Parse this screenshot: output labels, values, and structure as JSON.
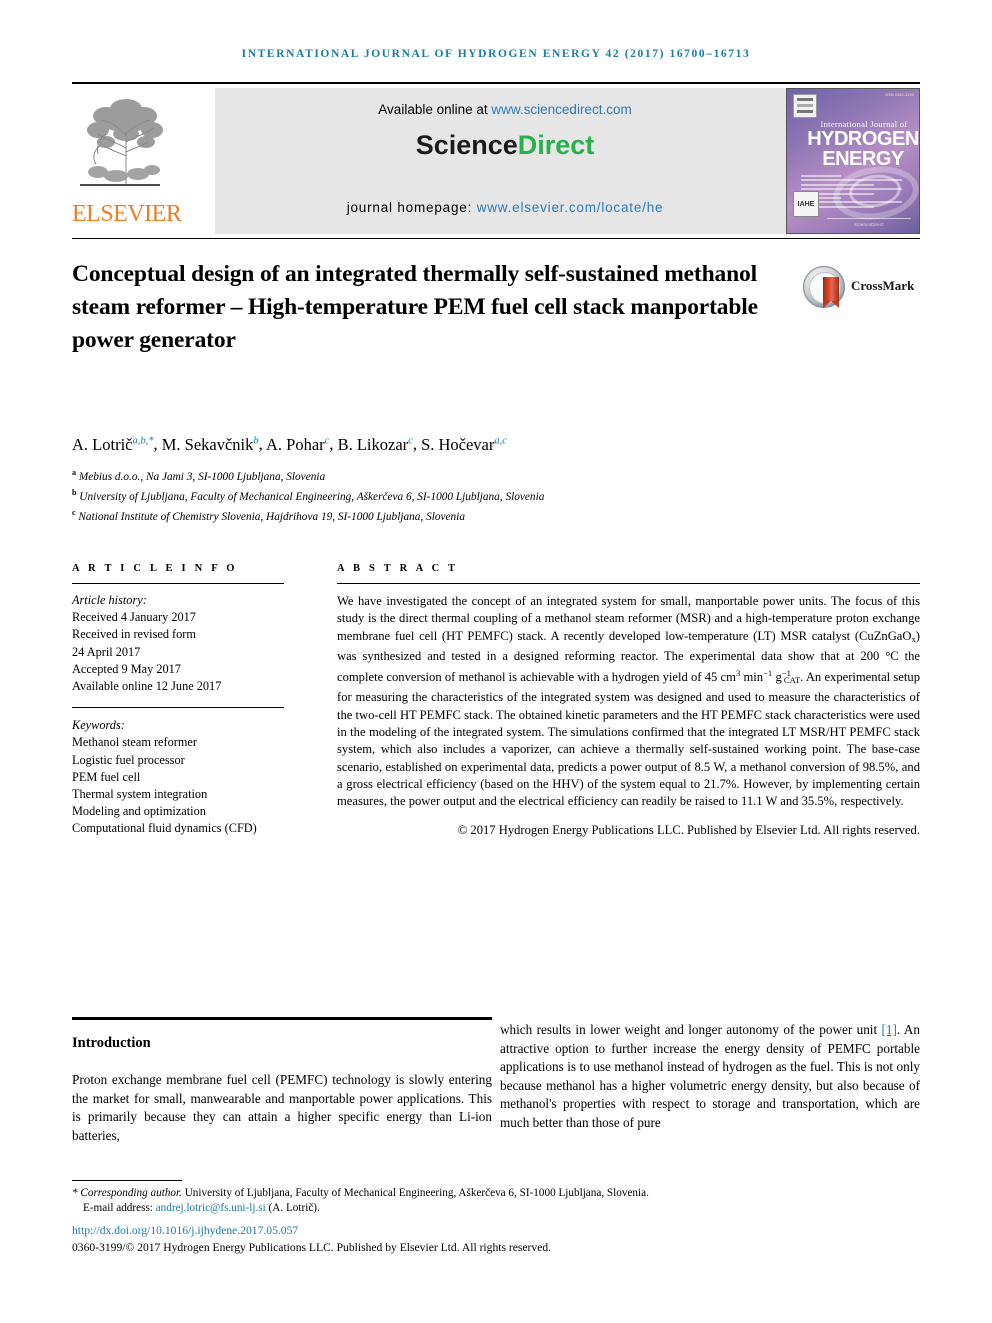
{
  "running_head": "International Journal of Hydrogen Energy 42 (2017) 16700–16713",
  "masthead": {
    "publisher_name": "ELSEVIER",
    "publisher_logo_alt": "elsevier-tree-logo",
    "available_online_label": "Available online at",
    "available_online_url": "www.sciencedirect.com",
    "brand_part1": "Science",
    "brand_part2": "Direct",
    "homepage_label": "journal homepage:",
    "homepage_url": "www.elsevier.com/locate/he",
    "cover": {
      "line1": "International Journal of",
      "line2": "HYDROGEN",
      "line3": "ENERGY",
      "footer": "ScienceDirect",
      "badge_label": "IAHE",
      "corner_note": "ISSN 0360-3199"
    }
  },
  "article": {
    "title": "Conceptual design of an integrated thermally self-sustained methanol steam reformer – High-temperature PEM fuel cell stack manportable power generator",
    "crossmark_label": "CrossMark",
    "authors": [
      {
        "name": "A. Lotrič",
        "marks": "a,b,*"
      },
      {
        "name": "M. Sekavčnik",
        "marks": "b"
      },
      {
        "name": "A. Pohar",
        "marks": "c"
      },
      {
        "name": "B. Likozar",
        "marks": "c"
      },
      {
        "name": "S. Hočevar",
        "marks": "a,c"
      }
    ],
    "affiliations": [
      {
        "mark": "a",
        "text": "Mebius d.o.o., Na Jami 3, SI-1000 Ljubljana, Slovenia"
      },
      {
        "mark": "b",
        "text": "University of Ljubljana, Faculty of Mechanical Engineering, Aškerčeva 6, SI-1000 Ljubljana, Slovenia"
      },
      {
        "mark": "c",
        "text": "National Institute of Chemistry Slovenia, Hajdrihova 19, SI-1000 Ljubljana, Slovenia"
      }
    ]
  },
  "article_info": {
    "heading": "A R T I C L E  I N F O",
    "history_label": "Article history:",
    "history": [
      "Received 4 January 2017",
      "Received in revised form",
      "24 April 2017",
      "Accepted 9 May 2017",
      "Available online 12 June 2017"
    ],
    "keywords_label": "Keywords:",
    "keywords": [
      "Methanol steam reformer",
      "Logistic fuel processor",
      "PEM fuel cell",
      "Thermal system integration",
      "Modeling and optimization",
      "Computational fluid dynamics (CFD)"
    ]
  },
  "abstract": {
    "heading": "A B S T R A C T",
    "paragraph_part1": "We have investigated the concept of an integrated system for small, manportable power units. The focus of this study is the direct thermal coupling of a methanol steam reformer (MSR) and a high-temperature proton exchange membrane fuel cell (HT PEMFC) stack. A recently developed low-temperature (LT) MSR catalyst (CuZnGaO",
    "catalyst_sub": "x",
    "paragraph_part2": ") was synthesized and tested in a designed reforming reactor. The experimental data show that at 200 °C the complete conversion of methanol is achievable with a hydrogen yield of 45 cm",
    "unit_sup1": "3",
    "paragraph_part3": " min",
    "unit_sup2": "−1",
    "paragraph_part4": " g",
    "unit_sub_cat": "CAT",
    "unit_sup3": "−1",
    "paragraph_part5": ". An experimental setup for measuring the characteristics of the integrated system was designed and used to measure the characteristics of the two-cell HT PEMFC stack. The obtained kinetic parameters and the HT PEMFC stack characteristics were used in the modeling of the integrated system. The simulations confirmed that the integrated LT MSR/HT PEMFC stack system, which also includes a vaporizer, can achieve a thermally self-sustained working point. The base-case scenario, established on experimental data, predicts a power output of 8.5 W, a methanol conversion of 98.5%, and a gross electrical efficiency (based on the HHV) of the system equal to 21.7%. However, by implementing certain measures, the power output and the electrical efficiency can readily be raised to 11.1 W and 35.5%, respectively.",
    "copyright": "© 2017 Hydrogen Energy Publications LLC. Published by Elsevier Ltd. All rights reserved."
  },
  "body": {
    "intro_heading": "Introduction",
    "left_column": "Proton exchange membrane fuel cell (PEMFC) technology is slowly entering the market for small, manwearable and manportable power applications. This is primarily because they can attain a higher specific energy than Li-ion batteries,",
    "right_column_before_ref": "which results in lower weight and longer autonomy of the power unit ",
    "right_column_ref": "[1]",
    "right_column_after_ref": ". An attractive option to further increase the energy density of PEMFC portable applications is to use methanol instead of hydrogen as the fuel. This is not only because methanol has a higher volumetric energy density, but also because of methanol's properties with respect to storage and transportation, which are much better than those of pure"
  },
  "footer": {
    "corresponding_label": "* Corresponding author.",
    "corresponding_text": " University of Ljubljana, Faculty of Mechanical Engineering, Aškerčeva 6, SI-1000 Ljubljana, Slovenia.",
    "email_label": "E-mail address:",
    "email": "andrej.lotric@fs.uni-lj.si",
    "email_attrib": "(A. Lotrič).",
    "doi": "http://dx.doi.org/10.1016/j.ijhydene.2017.05.057",
    "issn_line": "0360-3199/© 2017 Hydrogen Energy Publications LLC. Published by Elsevier Ltd. All rights reserved."
  },
  "colors": {
    "link_blue": "#1a7ba8",
    "sciencedirect_green": "#26b14c",
    "elsevier_orange": "#ef7d22",
    "banner_grey": "#e6e6e6"
  }
}
